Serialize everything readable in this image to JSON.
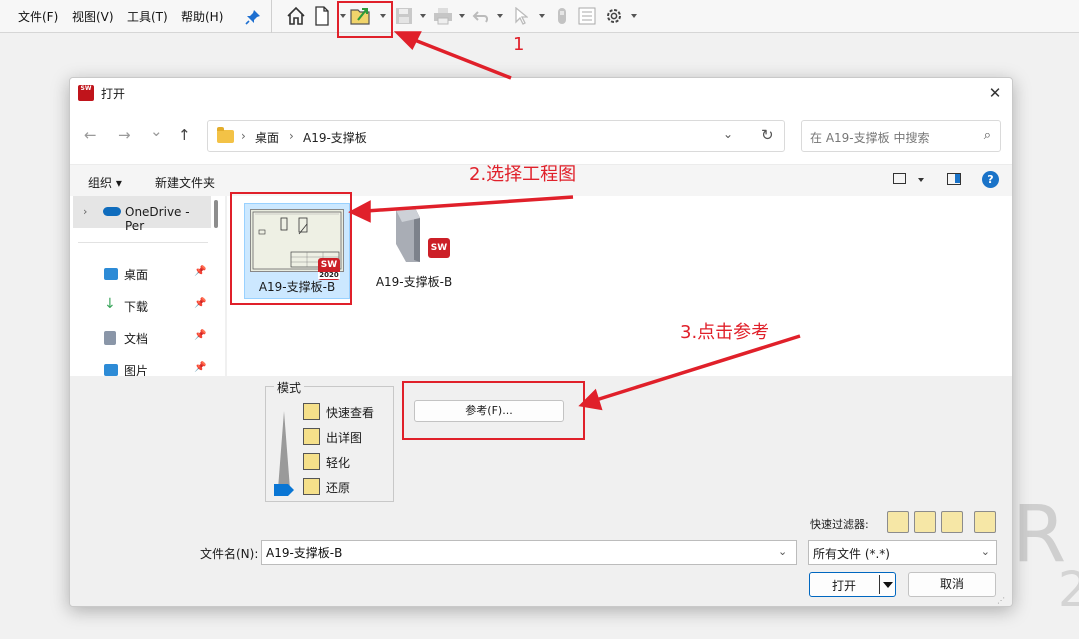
{
  "menubar": {
    "items": [
      "文件(F)",
      "视图(V)",
      "工具(T)",
      "帮助(H)"
    ]
  },
  "toolbar": {
    "icons": [
      "home-icon",
      "new-file-icon",
      "open-icon",
      "save-icon",
      "print-icon",
      "undo-icon",
      "select-icon",
      "rebuild-icon",
      "file-properties-icon",
      "options-icon"
    ]
  },
  "background": {
    "brand_fragment": "R",
    "brand_fragment2": "2"
  },
  "dialog": {
    "title": "打开",
    "close": "✕",
    "nav": {
      "back": "←",
      "forward": "→",
      "recent": "⌄",
      "up": "↑"
    },
    "breadcrumb": [
      "桌面",
      "A19-支撑板"
    ],
    "breadcrumb_sep": "›",
    "search_placeholder": "在 A19-支撑板 中搜索",
    "commands": {
      "organize": "组织 ▾",
      "new_folder": "新建文件夹"
    },
    "help": "?",
    "leftnav": {
      "top_item": "OneDrive - Per",
      "items": [
        {
          "label": "桌面",
          "color": "#2d8bd6"
        },
        {
          "label": "下载",
          "color": "#3aa55b"
        },
        {
          "label": "文档",
          "color": "#8a96a8"
        },
        {
          "label": "图片",
          "color": "#2d8bd6"
        }
      ]
    },
    "files": [
      {
        "name": "A19-支撑板-B",
        "selected": true,
        "badge": "2020"
      },
      {
        "name": "A19-支撑板-B",
        "selected": false
      }
    ],
    "mode": {
      "legend": "模式",
      "items": [
        "快速查看",
        "出详图",
        "轻化",
        "还原"
      ]
    },
    "references_button": "参考(F)...",
    "quick_filter_label": "快速过滤器:",
    "filename_label": "文件名(N):",
    "filename_value": "A19-支撑板-B",
    "filetype_value": "所有文件 (*.*)",
    "open_button": "打开",
    "cancel_button": "取消"
  },
  "annotations": {
    "step1": "1",
    "step2": "2.选择工程图",
    "step3": "3.点击参考",
    "color": "#e0202a"
  }
}
